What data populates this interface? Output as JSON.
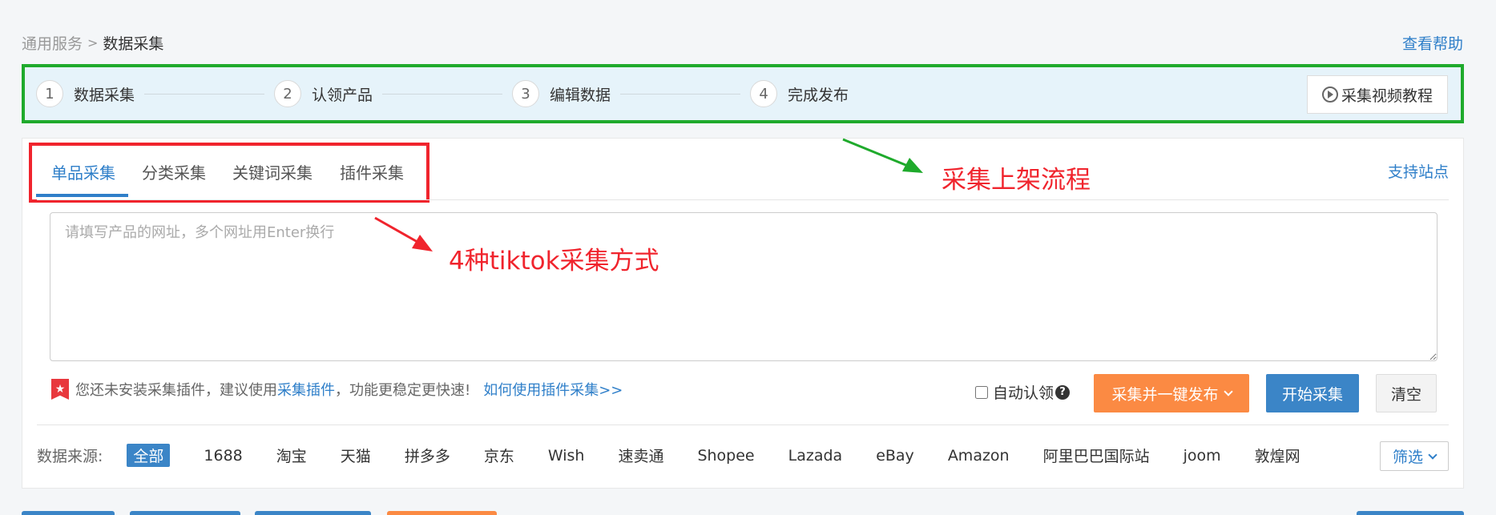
{
  "breadcrumb": {
    "parent": "通用服务",
    "separator": ">",
    "current": "数据采集"
  },
  "help_link": "查看帮助",
  "steps": [
    {
      "num": "1",
      "label": "数据采集"
    },
    {
      "num": "2",
      "label": "认领产品"
    },
    {
      "num": "3",
      "label": "编辑数据"
    },
    {
      "num": "4",
      "label": "完成发布"
    }
  ],
  "video_tutorial": "采集视频教程",
  "tabs": [
    {
      "label": "单品采集"
    },
    {
      "label": "分类采集"
    },
    {
      "label": "关键词采集"
    },
    {
      "label": "插件采集"
    }
  ],
  "support_link": "支持站点",
  "url_input": {
    "placeholder": "请填写产品的网址，多个网址用Enter换行",
    "value": ""
  },
  "plugin_notice": {
    "text_before": "您还未安装采集插件，建议使用",
    "link": "采集插件",
    "text_after": "，功能更稳定更快速!",
    "howto": "如何使用插件采集>>"
  },
  "auto_claim": {
    "label": "自动认领",
    "checked": false
  },
  "buttons": {
    "collect_publish": "采集并一键发布",
    "start": "开始采集",
    "clear": "清空"
  },
  "sources": {
    "label": "数据来源:",
    "items": [
      "全部",
      "1688",
      "淘宝",
      "天猫",
      "拼多多",
      "京东",
      "Wish",
      "速卖通",
      "Shopee",
      "Lazada",
      "eBay",
      "Amazon",
      "阿里巴巴国际站",
      "joom",
      "敦煌网"
    ],
    "selected": "全部"
  },
  "filter_button": "筛选",
  "annotations": {
    "flow": "采集上架流程",
    "methods": "4种tiktok采集方式"
  },
  "colors": {
    "accent": "#2f7fc9",
    "orange": "#fb8a43",
    "annotation_red": "#f0242d",
    "annotation_green": "#1faa2c"
  }
}
